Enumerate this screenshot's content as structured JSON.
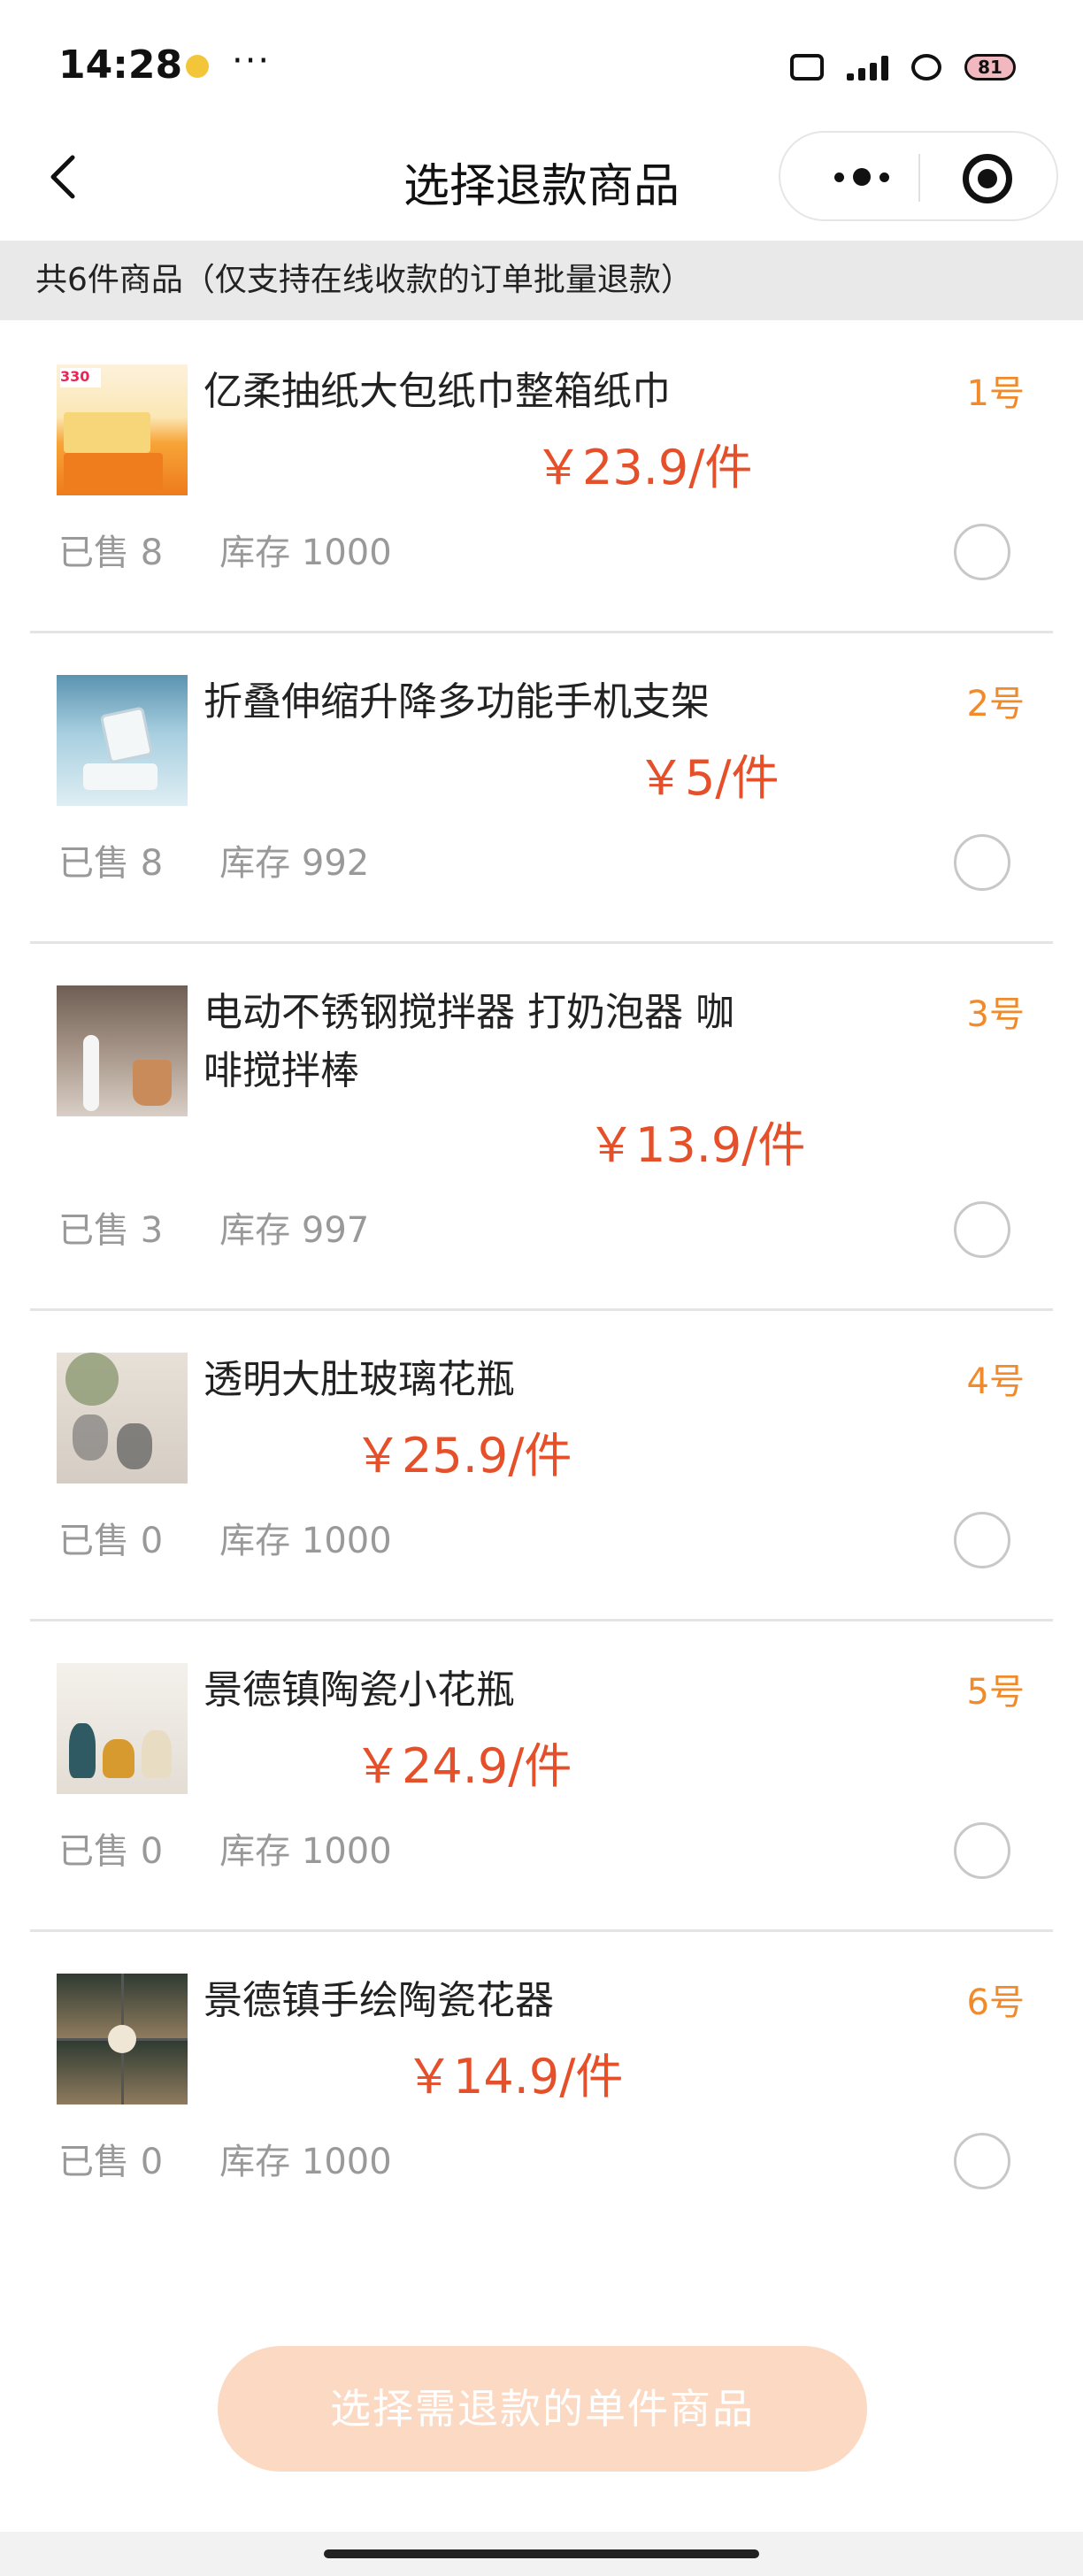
{
  "status_bar": {
    "time": "14:28",
    "more": "···",
    "battery": "81"
  },
  "nav": {
    "title": "选择退款商品"
  },
  "banner": {
    "text": "共6件商品（仅支持在线收款的订单批量退款）"
  },
  "products": [
    {
      "index": "1号",
      "name": "亿柔抽纸大包纸巾整箱纸巾",
      "price": "￥23.9/件",
      "sold": "已售 8",
      "stock": "库存 1000",
      "thumb_text": "330"
    },
    {
      "index": "2号",
      "name": "折叠伸缩升降多功能手机支架",
      "price": "￥5/件",
      "sold": "已售 8",
      "stock": "库存 992"
    },
    {
      "index": "3号",
      "name": "电动不锈钢搅拌器 打奶泡器 咖啡搅拌棒",
      "price": "￥13.9/件",
      "sold": "已售 3",
      "stock": "库存 997"
    },
    {
      "index": "4号",
      "name": "透明大肚玻璃花瓶",
      "price": "￥25.9/件",
      "sold": "已售 0",
      "stock": "库存 1000"
    },
    {
      "index": "5号",
      "name": "景德镇陶瓷小花瓶",
      "price": "￥24.9/件",
      "sold": "已售 0",
      "stock": "库存 1000"
    },
    {
      "index": "6号",
      "name": "景德镇手绘陶瓷花器",
      "price": "￥14.9/件",
      "sold": "已售 0",
      "stock": "库存 1000"
    }
  ],
  "cta": {
    "label": "选择需退款的单件商品"
  },
  "colors": {
    "price": "#e5502a",
    "index": "#f08a2a",
    "cta_bg": "#fcd9c2",
    "banner_bg": "#e9e9e9"
  }
}
